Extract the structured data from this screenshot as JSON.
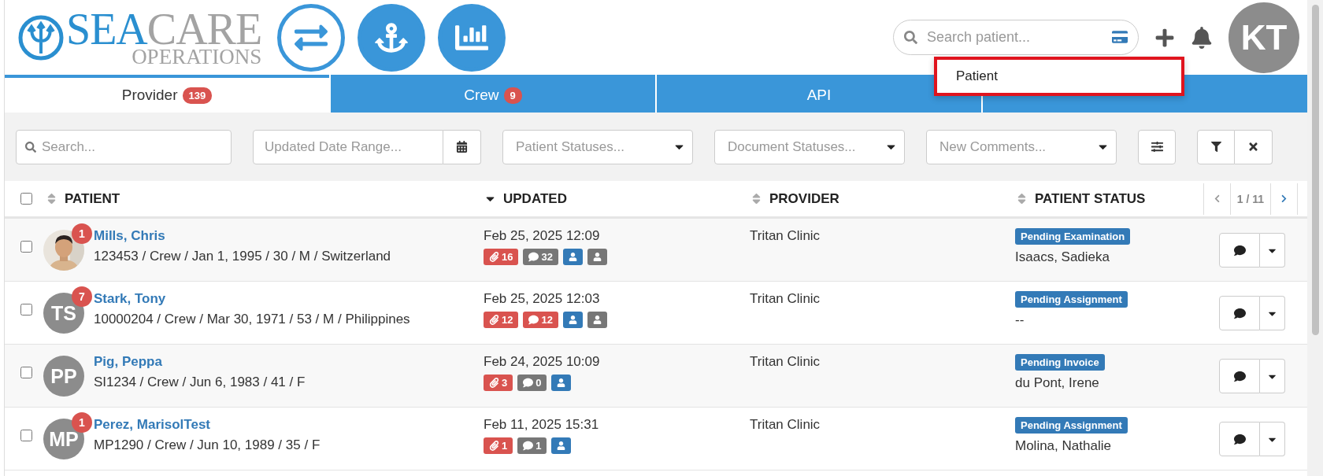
{
  "header": {
    "logo": {
      "primary": "SEA",
      "secondary": "CARE",
      "subtitle": "OPERATIONS"
    },
    "nav_buttons": [
      {
        "kind": "outline"
      },
      {
        "kind": "filled"
      },
      {
        "kind": "filled"
      }
    ],
    "search": {
      "placeholder": "Search patient..."
    },
    "user_initials": "KT"
  },
  "search_dropdown": {
    "items": [
      {
        "label": "Patient"
      }
    ]
  },
  "tabs": [
    {
      "label": "Provider",
      "badge": "139",
      "selected": true
    },
    {
      "label": "Crew",
      "badge": "9",
      "selected": false
    },
    {
      "label": "API",
      "selected": false
    },
    {
      "selected": false
    }
  ],
  "filters": {
    "search": {
      "placeholder": "Search..."
    },
    "date_range": {
      "placeholder": "Updated Date Range..."
    },
    "selects": [
      {
        "placeholder": "Patient Statuses..."
      },
      {
        "placeholder": "Document Statuses..."
      },
      {
        "placeholder": "New Comments..."
      }
    ]
  },
  "table": {
    "select_all": {
      "checked": false
    },
    "columns": [
      {
        "label": "PATIENT",
        "sorted": false
      },
      {
        "label": "UPDATED",
        "sorted": true
      },
      {
        "label": "PROVIDER",
        "sorted": false
      },
      {
        "label": "PATIENT STATUS",
        "sorted": false
      }
    ],
    "pager": "1 / 11",
    "rows": [
      {
        "checked": false,
        "notifications": "1",
        "name": "Mills, Chris",
        "details": "123453 / Crew / Jan 1, 1995 / 30 / M / Switzerland",
        "updated": "Feb 25, 2025 12:09",
        "tags": [
          {
            "kind": "attachments",
            "count": "16",
            "color": "#d9534f"
          },
          {
            "kind": "comments",
            "count": "32",
            "color": "#777777"
          },
          {
            "kind": "user",
            "color": "#337ab7"
          },
          {
            "kind": "user",
            "color": "#777777"
          }
        ],
        "provider": "Tritan Clinic",
        "status": "Pending Examination",
        "assignee": "Isaacs, Sadieka"
      },
      {
        "checked": false,
        "avatar": {
          "kind": "initials",
          "initials": "TS"
        },
        "notifications": "7",
        "name": "Stark, Tony",
        "details": "10000204 / Crew / Mar 30, 1971 / 53 / M / Philippines",
        "updated": "Feb 25, 2025 12:03",
        "tags": [
          {
            "kind": "attachments",
            "count": "12",
            "color": "#d9534f"
          },
          {
            "kind": "comments",
            "count": "12",
            "color": "#d9534f"
          },
          {
            "kind": "user",
            "color": "#337ab7"
          },
          {
            "kind": "user",
            "color": "#777777"
          }
        ],
        "provider": "Tritan Clinic",
        "status": "Pending Assignment",
        "assignee": "--"
      },
      {
        "checked": false,
        "avatar": {
          "kind": "initials",
          "initials": "PP"
        },
        "name": "Pig, Peppa",
        "details": "SI1234 / Crew / Jun 6, 1983 / 41 / F",
        "updated": "Feb 24, 2025 10:09",
        "tags": [
          {
            "kind": "attachments",
            "count": "3",
            "color": "#d9534f"
          },
          {
            "kind": "comments",
            "count": "0",
            "color": "#777777"
          },
          {
            "kind": "user",
            "color": "#337ab7"
          }
        ],
        "provider": "Tritan Clinic",
        "status": "Pending Invoice",
        "assignee": "du Pont, Irene"
      },
      {
        "checked": false,
        "avatar": {
          "kind": "initials",
          "initials": "MP"
        },
        "notifications": "1",
        "name": "Perez, MarisolTest",
        "details": "MP1290 / Crew / Jun 10, 1989 / 35 / F",
        "updated": "Feb 11, 2025 15:31",
        "tags": [
          {
            "kind": "attachments",
            "count": "1",
            "color": "#d9534f"
          },
          {
            "kind": "comments",
            "count": "1",
            "color": "#777777"
          },
          {
            "kind": "user",
            "color": "#337ab7"
          }
        ],
        "provider": "Tritan Clinic",
        "status": "Pending Assignment",
        "assignee": "Molina, Nathalie"
      }
    ]
  }
}
